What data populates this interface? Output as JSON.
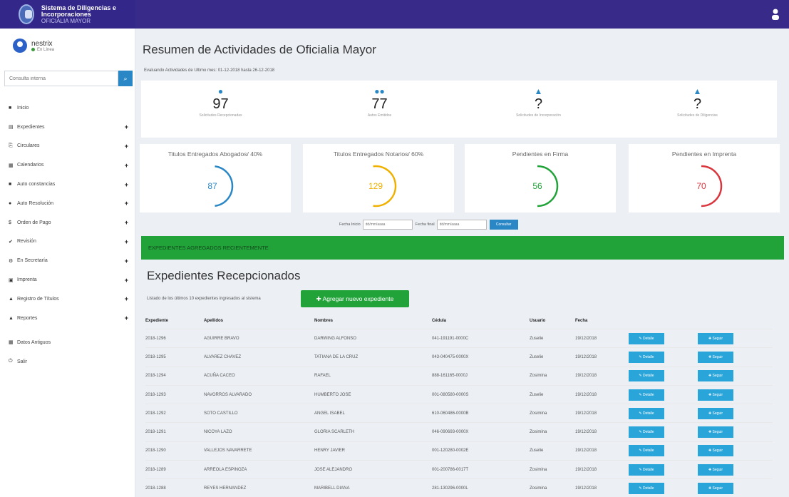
{
  "header": {
    "title": "Sistema de Diligencias e Incorporaciones",
    "subtitle": "OFICIALIA MAYOR",
    "colors": {
      "bar": "#372a89"
    }
  },
  "sidebar": {
    "user_name": "nestrix",
    "user_status": "En Línea",
    "search_placeholder": "Consulta interna",
    "items": [
      {
        "icon": "home-icon",
        "glyph": "■",
        "label": "Inicio",
        "expandable": false
      },
      {
        "icon": "folder-icon",
        "glyph": "▤",
        "label": "Expedientes",
        "expandable": true
      },
      {
        "icon": "copy-icon",
        "glyph": "⎘",
        "label": "Circulares",
        "expandable": true
      },
      {
        "icon": "calendar-icon",
        "glyph": "▦",
        "label": "Calendarios",
        "expandable": true
      },
      {
        "icon": "book-icon",
        "glyph": "■",
        "label": "Auto constancias",
        "expandable": true
      },
      {
        "icon": "gavel-icon",
        "glyph": "●",
        "label": "Auto Resolución",
        "expandable": true
      },
      {
        "icon": "dollar-icon",
        "glyph": "$",
        "label": "Orden de Pago",
        "expandable": true
      },
      {
        "icon": "check-icon",
        "glyph": "✔",
        "label": "Revisión",
        "expandable": true
      },
      {
        "icon": "gear-icon",
        "glyph": "⚙",
        "label": "En Secretaría",
        "expandable": true
      },
      {
        "icon": "print-icon",
        "glyph": "▣",
        "label": "Imprenta",
        "expandable": true
      },
      {
        "icon": "graduation-icon",
        "glyph": "▲",
        "label": "Registro de Títulos",
        "expandable": true
      },
      {
        "icon": "graduation-icon",
        "glyph": "▲",
        "label": "Reportes",
        "expandable": true
      }
    ],
    "items2": [
      {
        "icon": "database-icon",
        "glyph": "▦",
        "label": "Datos Antiguos"
      },
      {
        "icon": "power-icon",
        "glyph": "⏻",
        "label": "Salir"
      }
    ]
  },
  "main": {
    "title": "Resumen de Actividades de Oficialia Mayor",
    "subtitle": "Evaluando Actividades de Ultimo mes: 01-12-2018 hasta 26-12-2018",
    "stats": [
      {
        "icon": "user-icon",
        "glyph": "●",
        "value": "97",
        "label": "Solicitudes Recepcionadas"
      },
      {
        "icon": "users-icon",
        "glyph": "●●",
        "value": "77",
        "label": "Autos Emitidos"
      },
      {
        "icon": "graduation-icon",
        "glyph": "▲",
        "value": "?",
        "label": "Solicitudes de Incorporación"
      },
      {
        "icon": "graduation-icon",
        "glyph": "▲",
        "value": "?",
        "label": "Solicitudes de Diligencias"
      }
    ],
    "gauges": [
      {
        "title": "Titulos Entregados Abogados/ 40%",
        "value": "87",
        "color": "#2a87c6",
        "fraction": 0.4
      },
      {
        "title": "Titulos Entregados Notarios/ 60%",
        "value": "129",
        "color": "#f0b000",
        "fraction": 0.6
      },
      {
        "title": "Pendientes en Firma",
        "value": "56",
        "color": "#21a33a",
        "fraction": 0.5
      },
      {
        "title": "Pendientes en Imprenta",
        "value": "70",
        "color": "#d9363e",
        "fraction": 0.5
      }
    ],
    "filter": {
      "start_label": "Fecha Inicio",
      "start_placeholder": "dd/mm/aaaa",
      "end_label": "Fecha final",
      "end_placeholder": "dd/mm/aaaa",
      "button": "Consultar"
    },
    "banner": "EXPEDIENTES AGREGADOS RECIENTEMENTE",
    "section_title": "Expedientes Recepcionados",
    "section_desc": "Listado de los últimos 10 expedientes ingresados al sistema",
    "add_button": "✚ Agregar nuevo expediente"
  },
  "table": {
    "headers": [
      "Expediente",
      "Apellidos",
      "Nombres",
      "Cédula",
      "Usuario",
      "Fecha"
    ],
    "detail_label": "✎ Detalle",
    "follow_label": "✚ Seguir",
    "rows": [
      [
        "2018-1296",
        "AGUIRRE BRAVO",
        "DARWING ALFONSO",
        "041-191191-0000C",
        "Zuselie",
        "19/12/2018"
      ],
      [
        "2018-1295",
        "ALVAREZ CHAVEZ",
        "TATIANA DE LA CRUZ",
        "043-040475-0000X",
        "Zuselie",
        "19/12/2018"
      ],
      [
        "2018-1294",
        "ACUÑA CACEO",
        "RAFAEL",
        "888-161165-0000J",
        "Zosimina",
        "19/12/2018"
      ],
      [
        "2018-1293",
        "NAVORROS ALVARADO",
        "HUMBERTO JOSE",
        "001-080580-0000S",
        "Zuselie",
        "19/12/2018"
      ],
      [
        "2018-1292",
        "SOTO CASTILLO",
        "ANGEL ISABEL",
        "610-060486-0000B",
        "Zosimina",
        "19/12/2018"
      ],
      [
        "2018-1291",
        "NICOYA LAZO",
        "GLORIA SCARLETH",
        "046-090693-0000X",
        "Zosimina",
        "19/12/2018"
      ],
      [
        "2018-1290",
        "VALLEJOS NAVARRETE",
        "HENRY JAVIER",
        "001-120280-0002E",
        "Zuselie",
        "19/12/2018"
      ],
      [
        "2018-1289",
        "ARREOLA ESPINOZA",
        "JOSE ALEJANDRO",
        "001-200786-0017T",
        "Zosimina",
        "19/12/2018"
      ],
      [
        "2018-1288",
        "REYES HERNANDEZ",
        "MARIBELL DIANA",
        "281-130296-0000L",
        "Zosimina",
        "19/12/2018"
      ]
    ]
  }
}
